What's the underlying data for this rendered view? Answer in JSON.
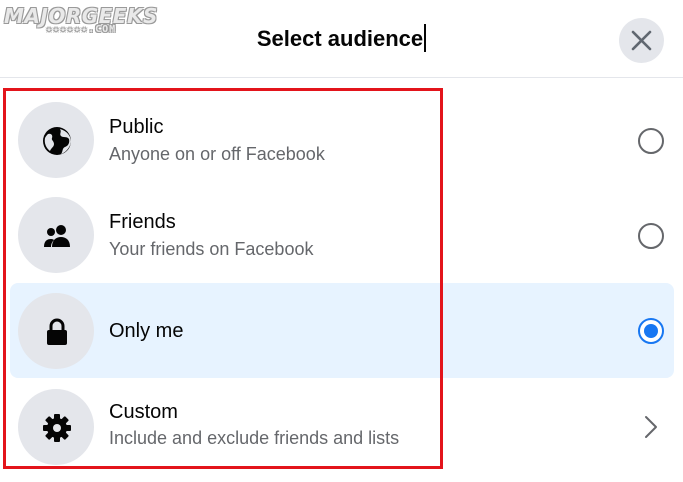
{
  "watermark": {
    "brand": "MAJORGEEKS",
    "sub": "★★★★★★.COM"
  },
  "dialog": {
    "title": "Select audience",
    "close_icon": "close-icon"
  },
  "options": [
    {
      "label": "Public",
      "description": "Anyone on or off Facebook",
      "icon": "globe-icon",
      "control": "radio",
      "selected": false
    },
    {
      "label": "Friends",
      "description": "Your friends on Facebook",
      "icon": "friends-icon",
      "control": "radio",
      "selected": false
    },
    {
      "label": "Only me",
      "description": "",
      "icon": "lock-icon",
      "control": "radio",
      "selected": true
    },
    {
      "label": "Custom",
      "description": "Include and exclude friends and lists",
      "icon": "gear-icon",
      "control": "chevron",
      "selected": false
    }
  ],
  "colors": {
    "accent": "#1877f2",
    "selected_bg": "#e7f3ff",
    "highlight_box": "#e3141b",
    "secondary_text": "#65676b"
  }
}
